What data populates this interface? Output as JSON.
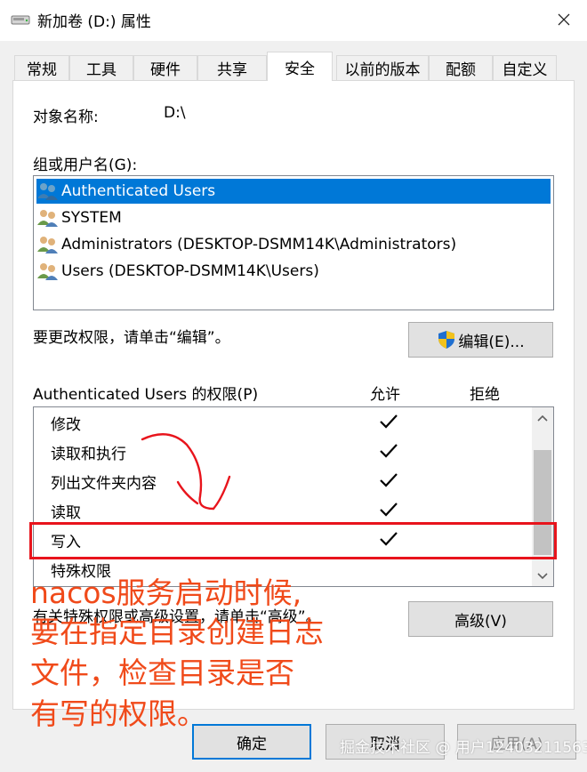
{
  "window": {
    "title": "新加卷 (D:) 属性"
  },
  "tabs": [
    {
      "label": "常规",
      "active": false
    },
    {
      "label": "工具",
      "active": false
    },
    {
      "label": "硬件",
      "active": false
    },
    {
      "label": "共享",
      "active": false
    },
    {
      "label": "安全",
      "active": true
    },
    {
      "label": "以前的版本",
      "active": false
    },
    {
      "label": "配额",
      "active": false
    },
    {
      "label": "自定义",
      "active": false
    }
  ],
  "security": {
    "object_label": "对象名称:",
    "object_value": "D:\\",
    "group_label": "组或用户名(G):",
    "users": [
      {
        "name": "Authenticated Users",
        "selected": true
      },
      {
        "name": "SYSTEM",
        "selected": false
      },
      {
        "name": "Administrators (DESKTOP-DSMM14K\\Administrators)",
        "selected": false
      },
      {
        "name": "Users (DESKTOP-DSMM14K\\Users)",
        "selected": false
      }
    ],
    "edit_hint": "要更改权限，请单击“编辑”。",
    "edit_button": "编辑(E)...",
    "perm_label": "Authenticated Users 的权限(P)",
    "allow_header": "允许",
    "deny_header": "拒绝",
    "permissions": [
      {
        "name": "修改",
        "allow": true,
        "deny": false
      },
      {
        "name": "读取和执行",
        "allow": true,
        "deny": false
      },
      {
        "name": "列出文件夹内容",
        "allow": true,
        "deny": false
      },
      {
        "name": "读取",
        "allow": true,
        "deny": false
      },
      {
        "name": "写入",
        "allow": true,
        "deny": false
      },
      {
        "name": "特殊权限",
        "allow": false,
        "deny": false
      }
    ],
    "advanced_hint": "有关特殊权限或高级设置，请单击“高级”。",
    "advanced_button": "高级(V)"
  },
  "footer": {
    "ok_button": "确定",
    "cancel_button": "取消",
    "apply_button": "应用(A)"
  },
  "annotation": {
    "lines": [
      "nacos服务启动时候,",
      "要在指定目录创建日志",
      "文件，检查目录是否",
      "有写的权限。"
    ],
    "color": "#f04a1a"
  },
  "watermark": "掘金技术社区 @ 用户1240321156396",
  "colors": {
    "selection": "#0078d7",
    "highlight_box": "#e8141c"
  }
}
